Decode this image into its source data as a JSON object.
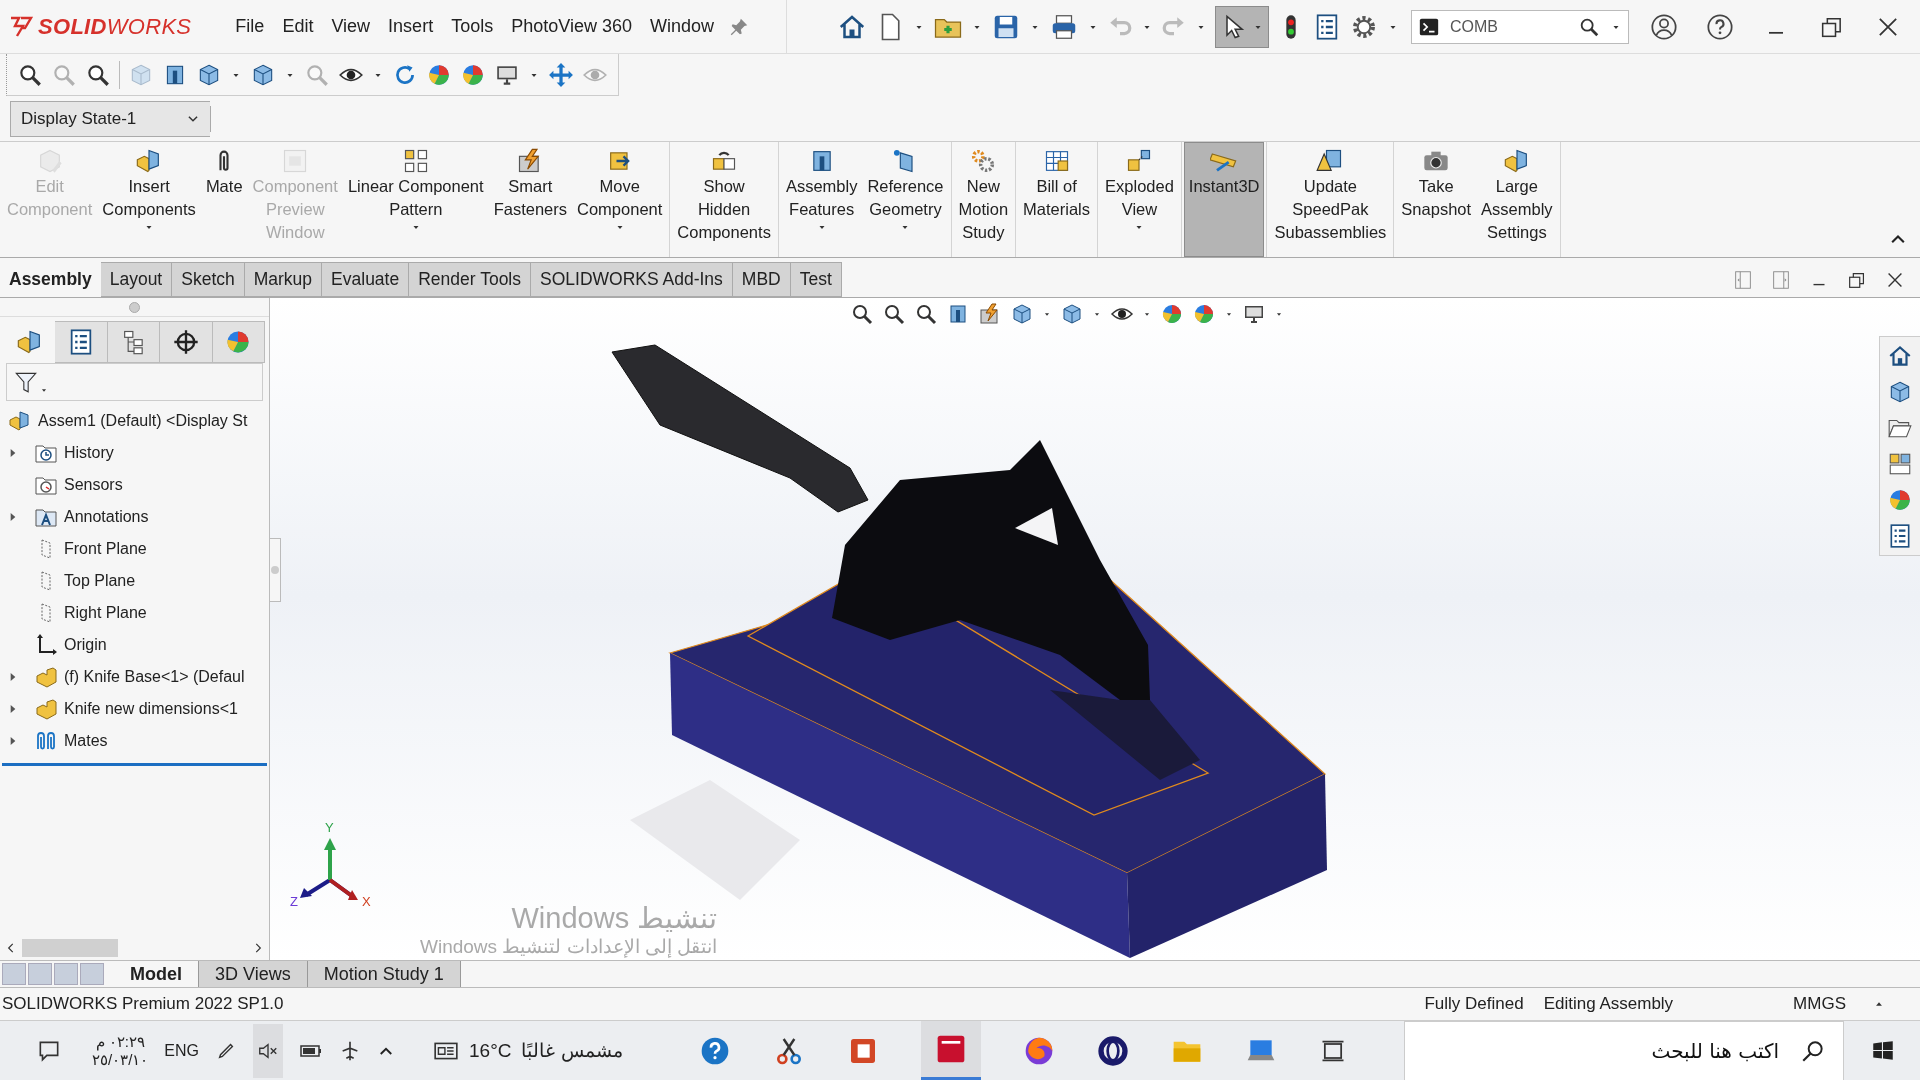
{
  "app": {
    "logo": "**SOLID**WORKS",
    "menu": [
      "File",
      "Edit",
      "View",
      "Insert",
      "Tools",
      "PhotoView 360",
      "Window"
    ],
    "select_tool": {
      "selected": true
    },
    "search": {
      "value": "COMB"
    }
  },
  "display_state": {
    "value": "Display State-1"
  },
  "ribbon": {
    "groups": [
      [
        {
          "label": "Edit\nComponent",
          "disabled": true,
          "dropdown": false,
          "selected": false
        },
        {
          "label": "Insert\nComponents",
          "disabled": false,
          "dropdown": true,
          "selected": false
        },
        {
          "label": "Mate",
          "disabled": false,
          "dropdown": false,
          "selected": false
        },
        {
          "label": "Component\nPreview\nWindow",
          "disabled": true,
          "dropdown": false,
          "selected": false
        },
        {
          "label": "Linear Component\nPattern",
          "disabled": false,
          "dropdown": true,
          "selected": false
        },
        {
          "label": "Smart\nFasteners",
          "disabled": false,
          "dropdown": false,
          "selected": false
        },
        {
          "label": "Move\nComponent",
          "disabled": false,
          "dropdown": true,
          "selected": false
        }
      ],
      [
        {
          "label": "Show\nHidden\nComponents",
          "disabled": false,
          "dropdown": false,
          "selected": false
        }
      ],
      [
        {
          "label": "Assembly\nFeatures",
          "disabled": false,
          "dropdown": true,
          "selected": false
        },
        {
          "label": "Reference\nGeometry",
          "disabled": false,
          "dropdown": true,
          "selected": false
        }
      ],
      [
        {
          "label": "New\nMotion\nStudy",
          "disabled": false,
          "dropdown": false,
          "selected": false
        }
      ],
      [
        {
          "label": "Bill of\nMaterials",
          "disabled": false,
          "dropdown": false,
          "selected": false
        }
      ],
      [
        {
          "label": "Exploded\nView",
          "disabled": false,
          "dropdown": true,
          "selected": false
        }
      ],
      [
        {
          "label": "Instant3D",
          "disabled": false,
          "dropdown": false,
          "selected": true
        }
      ],
      [
        {
          "label": "Update\nSpeedPak\nSubassemblies",
          "disabled": false,
          "dropdown": false,
          "selected": false
        }
      ],
      [
        {
          "label": "Take\nSnapshot",
          "disabled": false,
          "dropdown": false,
          "selected": false
        },
        {
          "label": "Large\nAssembly\nSettings",
          "disabled": false,
          "dropdown": false,
          "selected": false
        }
      ]
    ]
  },
  "tabs": [
    {
      "label": "Assembly",
      "selected": true
    },
    {
      "label": "Layout",
      "selected": false
    },
    {
      "label": "Sketch",
      "selected": false
    },
    {
      "label": "Markup",
      "selected": false
    },
    {
      "label": "Evaluate",
      "selected": false
    },
    {
      "label": "Render Tools",
      "selected": false
    },
    {
      "label": "SOLIDWORKS Add-Ins",
      "selected": false
    },
    {
      "label": "MBD",
      "selected": false
    },
    {
      "label": "Test",
      "selected": false
    }
  ],
  "feature_tree": {
    "root": {
      "label": "Assem1 (Default) <Display St",
      "children": [
        {
          "label": "History",
          "kind": "history",
          "expandable": true
        },
        {
          "label": "Sensors",
          "kind": "sensors",
          "expandable": false
        },
        {
          "label": "Annotations",
          "kind": "annotations",
          "expandable": true
        },
        {
          "label": "Front Plane",
          "kind": "plane",
          "expandable": false
        },
        {
          "label": "Top Plane",
          "kind": "plane",
          "expandable": false
        },
        {
          "label": "Right Plane",
          "kind": "plane",
          "expandable": false
        },
        {
          "label": "Origin",
          "kind": "origin",
          "expandable": false
        },
        {
          "label": "(f) Knife Base<1> (Defaul",
          "kind": "part",
          "expandable": true
        },
        {
          "label": "Knife new dimensions<1",
          "kind": "part",
          "expandable": true
        },
        {
          "label": "Mates",
          "kind": "mates",
          "expandable": true
        }
      ]
    }
  },
  "viewport": {
    "triad": {
      "x": "X",
      "y": "Y",
      "z": "Z"
    }
  },
  "activation": {
    "title": "تنشيط Windows",
    "message": "انتقل إلى الإعدادات لتنشيط Windows"
  },
  "bottom_tabs": [
    {
      "label": "Model",
      "selected": true
    },
    {
      "label": "3D Views",
      "selected": false
    },
    {
      "label": "Motion Study 1",
      "selected": false
    }
  ],
  "status_bar": {
    "product": "SOLIDWORKS Premium 2022 SP1.0",
    "items": [
      "Fully Defined",
      "Editing Assembly"
    ],
    "units": "MMGS"
  },
  "taskbar": {
    "time": "٠٢:٢٩ م",
    "date": "٢٥/٠٣/١٠",
    "language": "ENG",
    "weather": {
      "temperature": "16°C",
      "condition": "مشمس غالبًا"
    },
    "search": {
      "placeholder": "اكتب هنا للبحث"
    }
  }
}
